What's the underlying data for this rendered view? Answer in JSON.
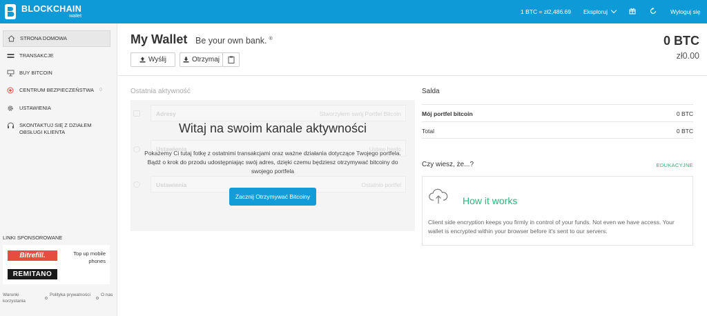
{
  "topbar": {
    "brand": "BLOCKCHAIN",
    "brand_sub": "wallet",
    "rate": "1 BTC =  zł2,486.69",
    "explore": "Eksploruj",
    "logout": "Wyloguj się"
  },
  "sidebar": {
    "items": [
      {
        "label": "STRONA DOMOWA"
      },
      {
        "label": "TRANSAKCJE"
      },
      {
        "label": "BUY BITCOIN"
      },
      {
        "label": "CENTRUM BEZPIECZEŃSTWA",
        "badge": "0"
      },
      {
        "label": "USTAWIENIA"
      },
      {
        "label": "SKONTAKTUJ SIĘ Z DZIAŁEM OBSŁUGI KLIENTA"
      }
    ],
    "sponsored_title": "LINKI SPONSOROWANE",
    "bitrefill": "Bitrefill.",
    "remitano": "REMITANO",
    "topup": "Top up mobile phones",
    "footer": [
      "Warunki korzystania",
      "Polityka prywatności",
      "O nas"
    ]
  },
  "header": {
    "title": "My Wallet",
    "tagline": "Be your own bank.",
    "reg": "®",
    "send": "Wyślij",
    "receive": "Otrzymaj",
    "balance_btc": "0 BTC",
    "balance_fiat": "zł0.00"
  },
  "activity": {
    "title": "Ostatnia aktywność",
    "ghost_rows": [
      {
        "left": "Adresy",
        "right": "Stworzyłem swój Portfel Bitcoin"
      },
      {
        "left": "Ustawienia",
        "right": "Ustaw hasło"
      },
      {
        "left": "Ustawienia",
        "right": "Ostatnio portfel"
      }
    ],
    "welcome_title": "Witaj na swoim kanale aktywności",
    "welcome_desc": "Pokażemy Ci tutaj fotkę z ostatnimi transakcjami oraz ważne działania dotyczące Twojego portfela. Bądź o krok do przodu udostępniając swój adres, dzięki czemu będziesz otrzymywać bitcoiny do swojego portfela",
    "start_button": "Zacznij Otrzymywać Bitcoiny"
  },
  "balances": {
    "title": "Salda",
    "rows": [
      {
        "label": "Mój portfel bitcoin",
        "value": "0 BTC"
      },
      {
        "label": "Total",
        "value": "0 BTC"
      }
    ]
  },
  "did_you_know": {
    "title": "Czy wiesz, że...?",
    "tag": "EDUKACYJNE",
    "card_title": "How it works",
    "card_desc": "Client side encryption keeps you firmly in control of your funds. Not even we have access. Your wallet is encrypted within your browser before it's sent to our servers."
  },
  "colors": {
    "brand": "#0e9ad6",
    "accent_green": "#2cb37a",
    "button_blue": "#139cd8"
  },
  "icons": {
    "logo": "blockchain-logo-icon",
    "gift": "gift-icon",
    "refresh": "refresh-icon",
    "home": "home-icon",
    "transactions": "transactions-icon",
    "buy": "buy-bitcoin-icon",
    "security": "security-center-icon",
    "settings": "gear-icon",
    "support": "headset-icon",
    "send": "upload-icon",
    "receive": "download-icon",
    "copy": "clipboard-icon",
    "cloud": "cloud-upload-icon"
  }
}
